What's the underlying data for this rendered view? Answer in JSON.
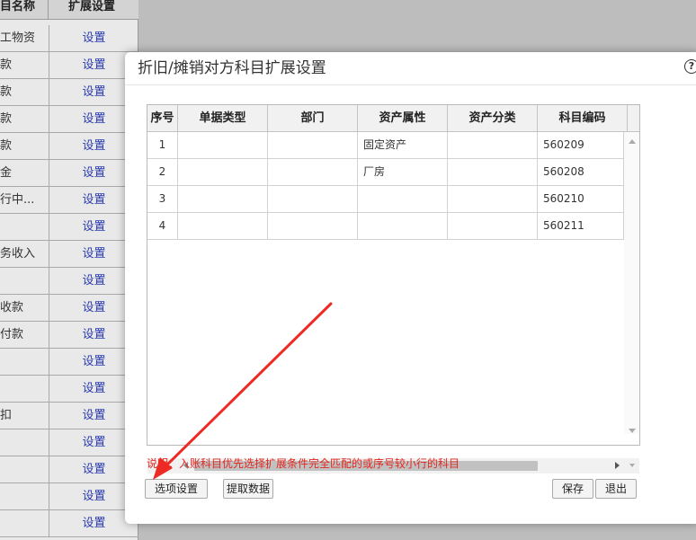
{
  "background": {
    "header": {
      "name_col": "目名称",
      "setting_col": "扩展设置"
    },
    "rows": [
      {
        "name": "工物资",
        "setting": "设置"
      },
      {
        "name": "款",
        "setting": "设置"
      },
      {
        "name": "款",
        "setting": "设置"
      },
      {
        "name": "款",
        "setting": "设置"
      },
      {
        "name": "款",
        "setting": "设置"
      },
      {
        "name": "金",
        "setting": "设置"
      },
      {
        "name": "行中...",
        "setting": "设置"
      },
      {
        "name": "",
        "setting": "设置"
      },
      {
        "name": "务收入",
        "setting": "设置"
      },
      {
        "name": "",
        "setting": "设置"
      },
      {
        "name": "收款",
        "setting": "设置"
      },
      {
        "name": "付款",
        "setting": "设置"
      },
      {
        "name": "",
        "setting": "设置"
      },
      {
        "name": "",
        "setting": "设置"
      },
      {
        "name": "扣",
        "setting": "设置"
      },
      {
        "name": "",
        "setting": "设置"
      },
      {
        "name": "",
        "setting": "设置"
      },
      {
        "name": "",
        "setting": "设置"
      },
      {
        "name": "",
        "setting": "设置"
      }
    ]
  },
  "dialog": {
    "title": "折旧/摊销对方科目扩展设置",
    "help_icon": "?",
    "columns": [
      "序号",
      "单据类型",
      "部门",
      "资产属性",
      "资产分类",
      "科目编码"
    ],
    "rows": [
      {
        "seq": "1",
        "doc_type": "",
        "dept": "",
        "asset_attr": "固定资产",
        "asset_class": "",
        "account_code": "560209"
      },
      {
        "seq": "2",
        "doc_type": "",
        "dept": "",
        "asset_attr": "厂房",
        "asset_class": "",
        "account_code": "560208"
      },
      {
        "seq": "3",
        "doc_type": "",
        "dept": "",
        "asset_attr": "",
        "asset_class": "",
        "account_code": "560210"
      },
      {
        "seq": "4",
        "doc_type": "",
        "dept": "",
        "asset_attr": "",
        "asset_class": "",
        "account_code": "560211"
      }
    ],
    "note": "说明：入账科目优先选择扩展条件完全匹配的或序号较小行的科目",
    "buttons": {
      "options": "选项设置",
      "fetch": "提取数据",
      "save": "保存",
      "exit": "退出"
    }
  },
  "colors": {
    "note": "#e0271f",
    "link": "#2a3bb0",
    "arrow": "#ee2a24"
  }
}
